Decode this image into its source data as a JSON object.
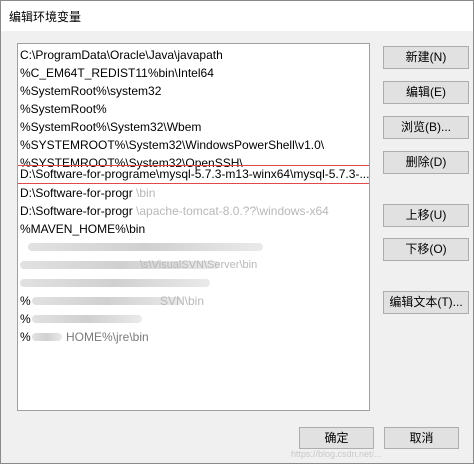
{
  "window": {
    "title": "编辑环境变量"
  },
  "path_list": {
    "items": [
      "C:\\ProgramData\\Oracle\\Java\\javapath",
      "%C_EM64T_REDIST11%bin\\Intel64",
      "%SystemRoot%\\system32",
      "%SystemRoot%",
      "%SystemRoot%\\System32\\Wbem",
      "%SYSTEMROOT%\\System32\\WindowsPowerShell\\v1.0\\",
      "%SYSTEMROOT%\\System32\\OpenSSH\\",
      "D:\\Software-for-programe\\mysql-5.7.3-m13-winx64\\mysql-5.7.3-...",
      "D:\\Software-for-progr",
      "D:\\Software-for-progr",
      "%MAVEN_HOME%\\bin",
      "",
      "",
      "",
      "%",
      "%",
      "%"
    ],
    "partial_suffixes": {
      "row_9": "\\bin",
      "row_10": "\\apache-tomcat-8.0.??\\windows-x64",
      "row_13": "\\s\\VisualSVN\\Server\\bin",
      "row_14": "SVN\\bin",
      "row_16": "HOME%\\jre\\bin"
    },
    "selected_index": 7
  },
  "buttons": {
    "new": "新建(N)",
    "edit": "编辑(E)",
    "browse": "浏览(B)...",
    "delete": "删除(D)",
    "move_up": "上移(U)",
    "move_down": "下移(O)",
    "edit_text": "编辑文本(T)...",
    "ok": "确定",
    "cancel": "取消"
  },
  "watermark": "https://blog.csdn.net/..."
}
